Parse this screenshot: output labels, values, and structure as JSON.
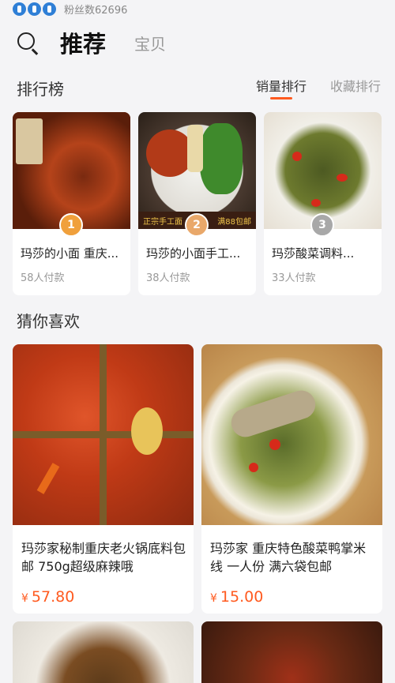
{
  "status": {
    "fans_text": "粉丝数62696"
  },
  "header": {
    "tab_active": "推荐",
    "tab_inactive": "宝贝"
  },
  "ranking": {
    "title": "排行榜",
    "tabs": [
      {
        "label": "销量排行",
        "active": true
      },
      {
        "label": "收藏排行",
        "active": false
      }
    ],
    "items": [
      {
        "rank": "1",
        "name": "玛莎的小面 重庆...",
        "sales": "58人付款"
      },
      {
        "rank": "2",
        "name": "玛莎的小面手工...",
        "sales": "38人付款"
      },
      {
        "rank": "3",
        "name": "玛莎酸菜调料...",
        "sales": "33人付款"
      }
    ],
    "item2_overlay": {
      "left": "正宗手工面",
      "right": "满88包邮"
    }
  },
  "guess": {
    "title": "猜你喜欢",
    "products": [
      {
        "name": "玛莎家秘制重庆老火锅底料包邮 750g超级麻辣哦",
        "currency": "¥",
        "price": "57.80"
      },
      {
        "name": "玛莎家 重庆特色酸菜鸭掌米线 一人份 满六袋包邮",
        "currency": "¥",
        "price": "15.00"
      }
    ]
  },
  "colors": {
    "accent": "#ff5a1f",
    "medal": "#2f7fd6"
  }
}
